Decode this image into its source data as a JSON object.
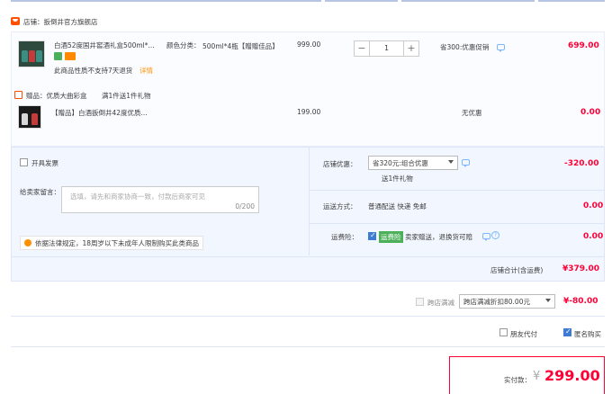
{
  "store": {
    "label": "店铺：",
    "name": "扳倒井官方旗舰店"
  },
  "items": [
    {
      "title": "白酒52度国井窖酒礼盒500ml*...",
      "spec_label": "颜色分类：",
      "spec_value": "500ml*4瓶【赠赠佳品】",
      "note": "此商品性质不支持7天退货",
      "note_link": "详情",
      "price": "999.00",
      "qty": "1",
      "promo": "省300:优惠促销",
      "subtotal": "699.00"
    }
  ],
  "gift": {
    "header": "赠品：优质大曲彩盒",
    "header_rule": "满1件送1件礼物",
    "title": "【赠品】白酒扳倒井42度优质...",
    "price": "199.00",
    "promo": "无优惠",
    "subtotal": "0.00"
  },
  "panel": {
    "invoice_label": "开具发票",
    "message_label": "给卖家留言：",
    "message_placeholder": "选填，请先和商家协商一致，付款后商家可见",
    "message_count": "0/200",
    "notice": "依据法律规定，18周岁以下未成年人限制购买此类商品",
    "discount_label": "店铺优惠：",
    "discount_select": "省320元:组合优惠",
    "discount_sub": "送1件礼物",
    "discount_value": "-320.00",
    "shipping_label": "运送方式：",
    "shipping_value": "普通配送 快递 免邮",
    "shipping_cost": "0.00",
    "insurance_label": "运费险：",
    "insurance_badge": "运费险",
    "insurance_text": "卖家赠送，退换货可赔",
    "insurance_cost": "0.00",
    "store_total_label": "店铺合计(含运费)",
    "store_total": "¥379.00"
  },
  "cross_store": {
    "label": "跨店满减",
    "select": "跨店满减折扣80.00元",
    "value": "¥-80.00"
  },
  "friend_pay_label": "朋友代付",
  "anonymous_label": "匿名购买",
  "actual_pay": {
    "label": "实付款：",
    "currency": "¥",
    "amount": "299.00"
  },
  "colors": {
    "accent": "#ff0036",
    "brand": "#ff5000",
    "blue": "#3e7bd2"
  }
}
